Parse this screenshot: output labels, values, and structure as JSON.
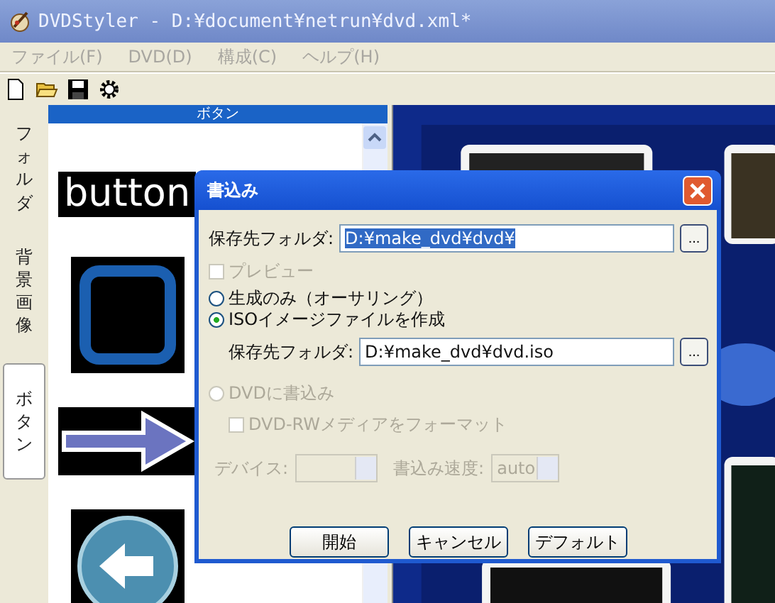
{
  "window": {
    "title": "DVDStyler - D:¥document¥netrun¥dvd.xml*"
  },
  "menu": [
    "ファイル(F)",
    "DVD(D)",
    "構成(C)",
    "ヘルプ(H)"
  ],
  "side_tabs": [
    {
      "label": "フォルダ",
      "selected": false
    },
    {
      "label": "背景画像",
      "selected": false
    },
    {
      "label": "ボタン",
      "selected": true
    }
  ],
  "panel": {
    "title": "ボタン",
    "items": [
      {
        "kind": "text",
        "label": "button"
      },
      {
        "kind": "square"
      },
      {
        "kind": "arrow"
      },
      {
        "kind": "circle"
      }
    ]
  },
  "dialog": {
    "title": "書込み",
    "folder": {
      "label": "保存先フォルダ:",
      "value": "D:¥make_dvd¥dvd¥",
      "browse": "..."
    },
    "preview": {
      "label": "プレビュー",
      "checked": false,
      "disabled": true
    },
    "modes": [
      {
        "label": "生成のみ（オーサリング）",
        "selected": false,
        "disabled": false
      },
      {
        "label": "ISOイメージファイルを作成",
        "selected": true,
        "disabled": false,
        "folder": {
          "label": "保存先フォルダ:",
          "value": "D:¥make_dvd¥dvd.iso",
          "browse": "..."
        }
      },
      {
        "label": "DVDに書込み",
        "selected": false,
        "disabled": true
      }
    ],
    "format": {
      "label": "DVD-RWメディアをフォーマット",
      "checked": false,
      "disabled": true
    },
    "device": {
      "label": "デバイス:",
      "disabled": true
    },
    "speed": {
      "label": "書込み速度:",
      "value": "auto",
      "disabled": true
    },
    "buttons": [
      "開始",
      "キャンセル",
      "デフォルト"
    ]
  }
}
